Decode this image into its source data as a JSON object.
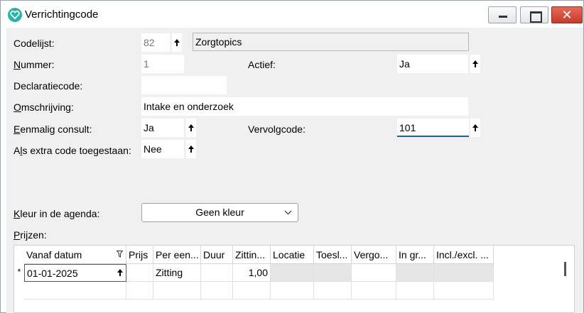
{
  "window": {
    "title": "Verrichtingcode",
    "close_glyph": "✕"
  },
  "form": {
    "codelijst_label": "Codelijst:",
    "codelijst_code": "82",
    "codelijst_name": "Zorgtopics",
    "nummer_label_u": "N",
    "nummer_label_rest": "ummer:",
    "nummer_value": "1",
    "actief_label": "Actief:",
    "actief_value": "Ja",
    "declaratiecode_label": "Declaratiecode:",
    "declaratiecode_value": "",
    "omschrijving_label_u": "O",
    "omschrijving_label_rest": "mschrijving:",
    "omschrijving_value": "Intake en onderzoek",
    "eenmalig_label_u": "E",
    "eenmalig_label_rest": "enmalig consult:",
    "eenmalig_value": "Ja",
    "vervolgcode_label_pre": "Vervol",
    "vervolgcode_label_u": "g",
    "vervolgcode_label_rest": "code:",
    "vervolgcode_value": "101",
    "extra_label_pre": "A",
    "extra_label_u": "l",
    "extra_label_rest": "s extra code toegestaan:",
    "extra_value": "Nee",
    "kleur_label_u": "K",
    "kleur_label_rest": "leur in de agenda:",
    "kleur_value": "Geen kleur",
    "prijzen_label_u": "P",
    "prijzen_label_rest": "rijzen:"
  },
  "grid": {
    "columns": [
      "Vanaf datum",
      "Prijs",
      "Per een...",
      "Duur",
      "Zittin...",
      "Locatie",
      "Toesl...",
      "Vergo...",
      "In gr...",
      "Incl./excl. ..."
    ],
    "new_row_marker": "*",
    "row": {
      "vanaf_datum": "01-01-2025",
      "prijs": "",
      "per_eenheid": "Zitting",
      "duur": "",
      "zittingen": "1,00",
      "locatie": "",
      "toeslag": "",
      "vergoeding": "",
      "in_groep": "",
      "incl_excl": ""
    }
  },
  "icons": [
    "app-heart-icon",
    "minimize-icon",
    "maximize-icon",
    "close-icon",
    "spin-arrow-icon",
    "chevron-down-icon",
    "filter-icon"
  ],
  "colors": {
    "app_icon": "#2bb3a3",
    "close_button": "#c93b2b",
    "focus_underline": "#1f5fa8"
  }
}
